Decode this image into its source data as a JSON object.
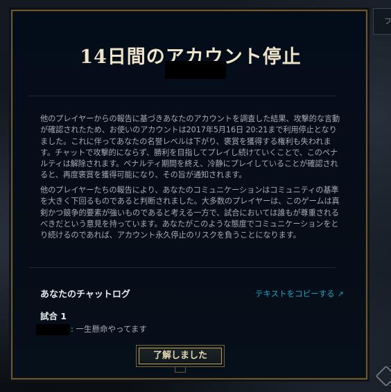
{
  "modal": {
    "title": "14日間のアカウント停止",
    "body_paragraphs": [
      "他のプレイヤーからの報告に基づきあなたのアカウントを調査した結果、攻撃的な言動が確認されたため、お使いのアカウントは2017年5月16日 20:21まで利用停止となりました。これに伴ってあなたの名誉レベルは下がり、褒賞を獲得する権利も失われます。チャットで攻撃的にならず、勝利を目指してプレイし続けていくことで、このペナルティは解除されます。ペナルティ期間を終え、冷静にプレイしていることが確認されると、再度褒賞を獲得可能になり、その旨が通知されます。",
      "他のプレイヤーたちの報告により、あなたのコミュニケーションはコミュニティの基準を大きく下回るものであると判断されました。大多数のプレイヤーは、このゲームは真剣かつ競争的要素が強いものであると考える一方で、試合においては誰もが尊重されるべきだという意見を持っています。あなたがこのような態度でコミュニケーションをとり続けるのであれば、アカウント永久停止のリスクを負うことになります。"
    ],
    "chatlog": {
      "title": "あなたのチャットログ",
      "copy_link": "テキストをコピーする",
      "copy_icon": "external-arrow-icon",
      "match_label": "試合 1",
      "message": ": 一生懸命やってます"
    },
    "ok_button": "了解しました"
  },
  "background": {
    "tab_label": "フ"
  },
  "colors": {
    "accent_gold": "#c2a55d",
    "link_cyan": "#19a6c4",
    "modal_bg": "#030d1a"
  }
}
